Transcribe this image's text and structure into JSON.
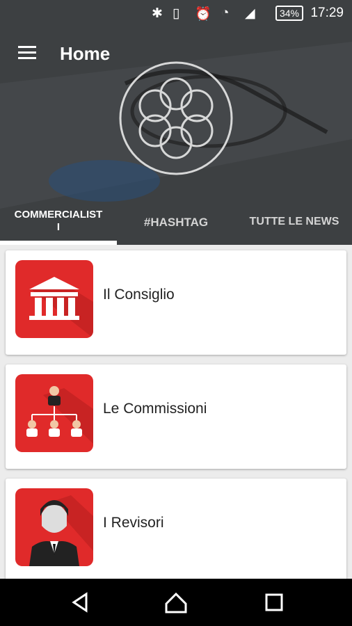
{
  "status_bar": {
    "time": "17:29",
    "battery": "34%"
  },
  "app_bar": {
    "title": "Home",
    "menu_icon": "hamburger-icon"
  },
  "tabs": [
    {
      "label": "COMMERCIALIST",
      "label_line2": "I",
      "active": true
    },
    {
      "label": "#HASHTAG",
      "active": false
    },
    {
      "label": "TUTTE LE NEWS",
      "active": false
    }
  ],
  "cards": [
    {
      "label": "Il Consiglio",
      "icon": "building-columns-icon"
    },
    {
      "label": "Le Commissioni",
      "icon": "org-chart-icon"
    },
    {
      "label": "I Revisori",
      "icon": "person-suit-icon"
    }
  ],
  "colors": {
    "accent_red": "#e02a2a",
    "header_bg": "#3f4244"
  },
  "nav_bar": {
    "back": "back-icon",
    "home": "home-icon",
    "recents": "recents-icon"
  }
}
